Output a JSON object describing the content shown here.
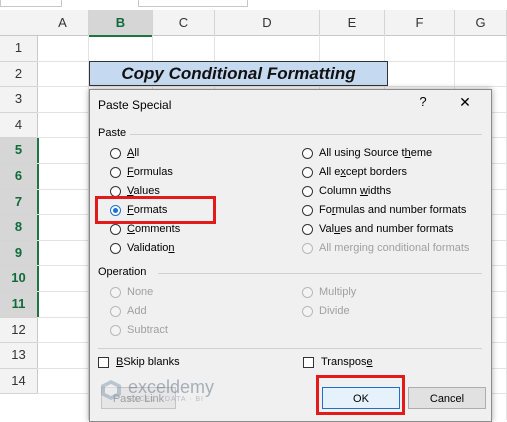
{
  "sheet": {
    "columns": [
      "A",
      "B",
      "C",
      "D",
      "E",
      "F",
      "G"
    ],
    "selected_column": "B",
    "rows": [
      "1",
      "2",
      "3",
      "4",
      "5",
      "6",
      "7",
      "8",
      "9",
      "10",
      "11",
      "12",
      "13",
      "14"
    ],
    "selected_rows": [
      "5",
      "6",
      "7",
      "8",
      "9",
      "10",
      "11"
    ],
    "title_text": "Copy Conditional Formatting"
  },
  "dialog": {
    "title": "Paste Special",
    "help": "?",
    "close": "✕",
    "paste_label": "Paste",
    "paste_left": [
      {
        "pre": "",
        "u": "A",
        "post": "ll",
        "checked": false
      },
      {
        "pre": "",
        "u": "F",
        "post": "ormulas",
        "checked": false
      },
      {
        "pre": "",
        "u": "V",
        "post": "alues",
        "checked": false
      },
      {
        "pre": "",
        "u": "T",
        "post": "Formats",
        "checked": true
      },
      {
        "pre": "",
        "u": "C",
        "post": "omments",
        "checked": false
      },
      {
        "pre": "Validatio",
        "u": "n",
        "post": "",
        "checked": false
      }
    ],
    "paste_right": [
      {
        "pre": "All using Source t",
        "u": "h",
        "post": "eme",
        "disabled": false
      },
      {
        "pre": "All e",
        "u": "x",
        "post": "cept borders",
        "disabled": false
      },
      {
        "pre": "Column ",
        "u": "w",
        "post": "idths",
        "disabled": false
      },
      {
        "pre": "Fo",
        "u": "r",
        "post": "mulas and number formats",
        "disabled": false
      },
      {
        "pre": "Val",
        "u": "u",
        "post": "es and number formats",
        "disabled": false
      },
      {
        "pre": "All merging conditional formats",
        "u": "",
        "post": "",
        "disabled": true
      }
    ],
    "operation_label": "Operation",
    "operation_left": [
      "None",
      "Add",
      "Subtract"
    ],
    "operation_right": [
      "Multiply",
      "Divide"
    ],
    "skip_blanks": {
      "pre": "",
      "u": "B",
      "post": "Skip blanks"
    },
    "transpose": {
      "pre": "Transpos",
      "u": "e",
      "post": ""
    },
    "paste_link": "Paste Link",
    "ok": "OK",
    "cancel": "Cancel"
  },
  "watermark": {
    "name": "exceldemy",
    "tagline": "EXCEL · DATA · BI"
  }
}
